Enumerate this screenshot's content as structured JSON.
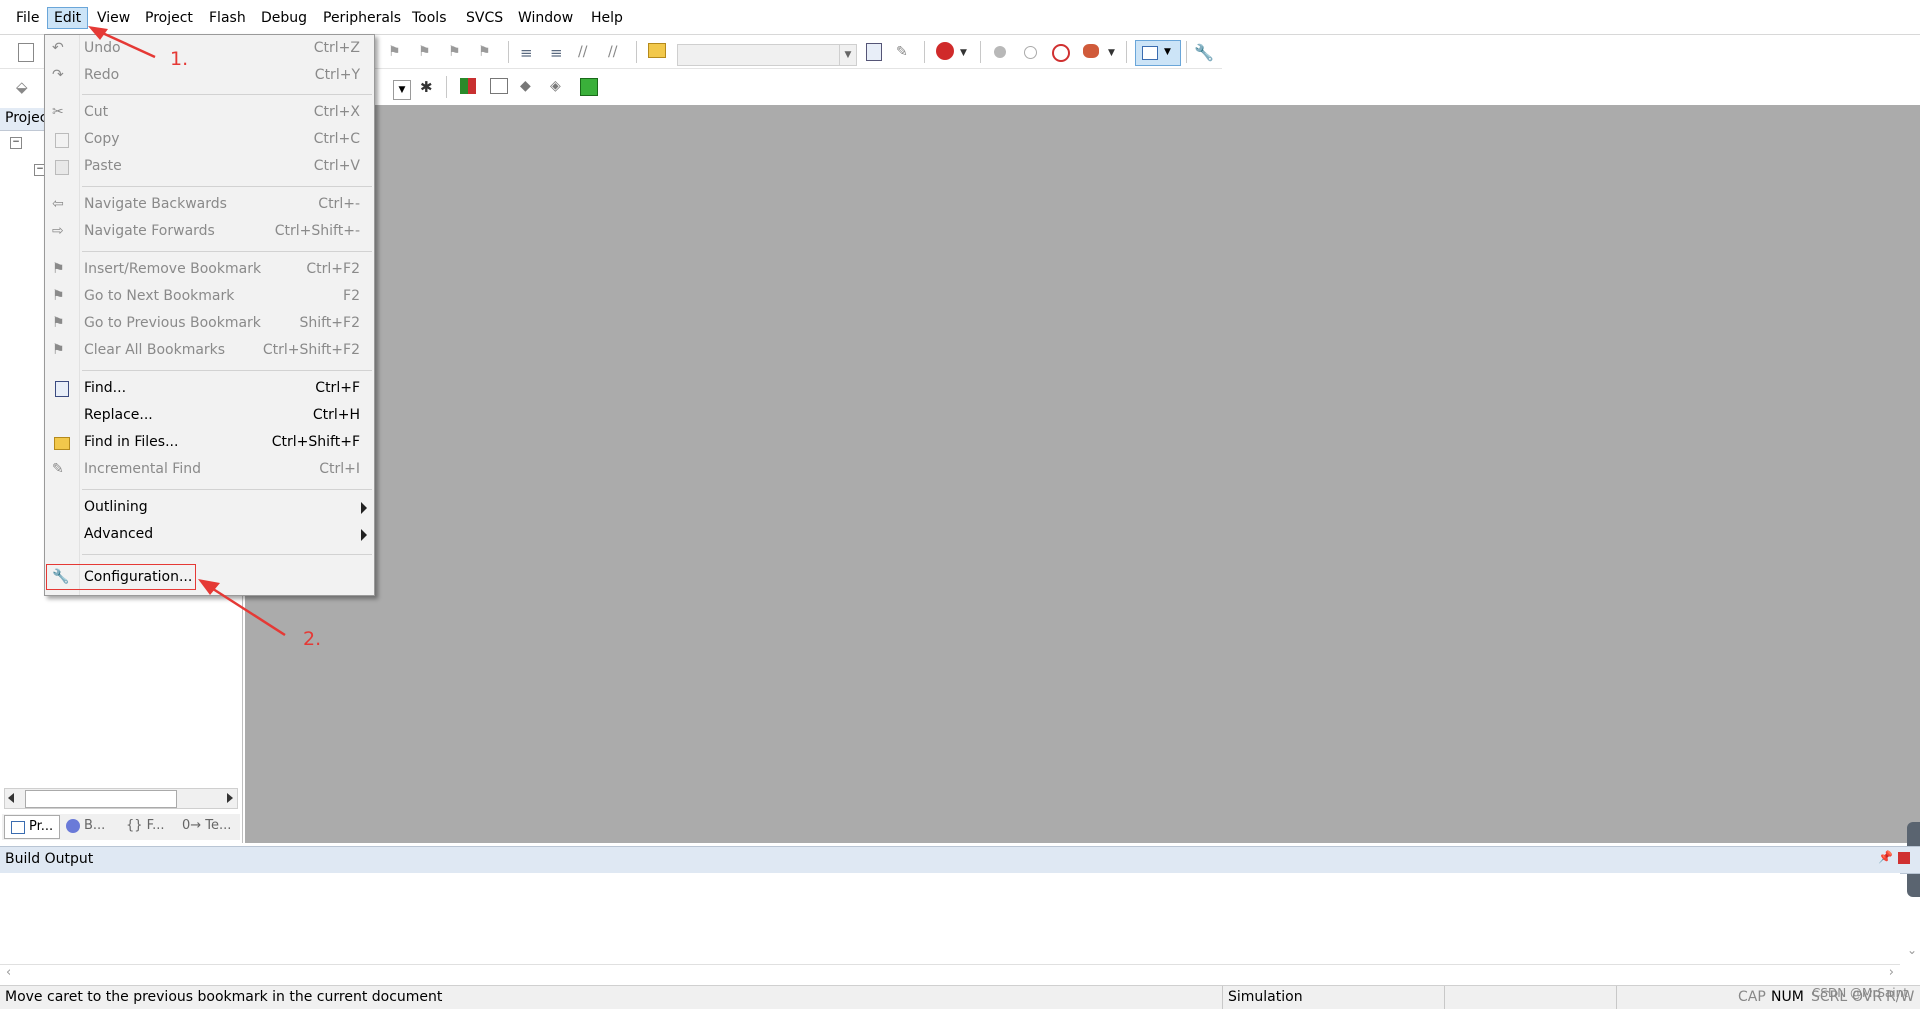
{
  "menubar": {
    "items": [
      "File",
      "Edit",
      "View",
      "Project",
      "Flash",
      "Debug",
      "Peripherals",
      "Tools",
      "SVCS",
      "Window",
      "Help"
    ],
    "active": "Edit"
  },
  "edit_menu": {
    "items": [
      {
        "label": "Undo",
        "shortcut": "Ctrl+Z",
        "enabled": false,
        "icon": "undo-icon"
      },
      {
        "label": "Redo",
        "shortcut": "Ctrl+Y",
        "enabled": false,
        "icon": "redo-icon"
      },
      {
        "label": "Cut",
        "shortcut": "Ctrl+X",
        "enabled": false,
        "icon": "cut-icon"
      },
      {
        "label": "Copy",
        "shortcut": "Ctrl+C",
        "enabled": false,
        "icon": "copy-icon"
      },
      {
        "label": "Paste",
        "shortcut": "Ctrl+V",
        "enabled": false,
        "icon": "paste-icon"
      },
      {
        "label": "Navigate Backwards",
        "shortcut": "Ctrl+-",
        "enabled": false,
        "icon": "arrow-left-icon"
      },
      {
        "label": "Navigate Forwards",
        "shortcut": "Ctrl+Shift+-",
        "enabled": false,
        "icon": "arrow-right-icon"
      },
      {
        "label": "Insert/Remove Bookmark",
        "shortcut": "Ctrl+F2",
        "enabled": false,
        "icon": "bookmark-icon"
      },
      {
        "label": "Go to Next Bookmark",
        "shortcut": "F2",
        "enabled": false,
        "icon": "bookmark-next-icon"
      },
      {
        "label": "Go to Previous Bookmark",
        "shortcut": "Shift+F2",
        "enabled": false,
        "icon": "bookmark-prev-icon"
      },
      {
        "label": "Clear All Bookmarks",
        "shortcut": "Ctrl+Shift+F2",
        "enabled": false,
        "icon": "bookmark-clear-icon"
      },
      {
        "label": "Find...",
        "shortcut": "Ctrl+F",
        "enabled": true,
        "icon": "find-icon"
      },
      {
        "label": "Replace...",
        "shortcut": "Ctrl+H",
        "enabled": true,
        "icon": ""
      },
      {
        "label": "Find in Files...",
        "shortcut": "Ctrl+Shift+F",
        "enabled": true,
        "icon": "find-in-files-icon"
      },
      {
        "label": "Incremental Find",
        "shortcut": "Ctrl+I",
        "enabled": false,
        "icon": "incremental-find-icon"
      },
      {
        "label": "Outlining",
        "shortcut": "",
        "enabled": true,
        "icon": "",
        "submenu": true
      },
      {
        "label": "Advanced",
        "shortcut": "",
        "enabled": true,
        "icon": "",
        "submenu": true
      },
      {
        "label": "Configuration...",
        "shortcut": "",
        "enabled": true,
        "icon": "wrench-icon"
      }
    ]
  },
  "left_panel": {
    "header": "Projec",
    "tabs": [
      "Pr...",
      "B...",
      "{} F...",
      "0→ Te..."
    ]
  },
  "build_output": {
    "title": "Build Output"
  },
  "status_bar": {
    "message": "Move caret to the previous bookmark in the current document",
    "mode": "Simulation",
    "indicators": [
      "CAP",
      "NUM",
      "SCRL",
      "OVR",
      "R/W"
    ]
  },
  "annotations": {
    "step1": "1.",
    "step2": "2."
  },
  "watermark": "CSDN @MrSaint",
  "colors": {
    "annotation_red": "#e53935",
    "workspace_grey": "#ababab",
    "menu_bg": "#f2f2f2",
    "active_menu": "#cce4f7"
  }
}
